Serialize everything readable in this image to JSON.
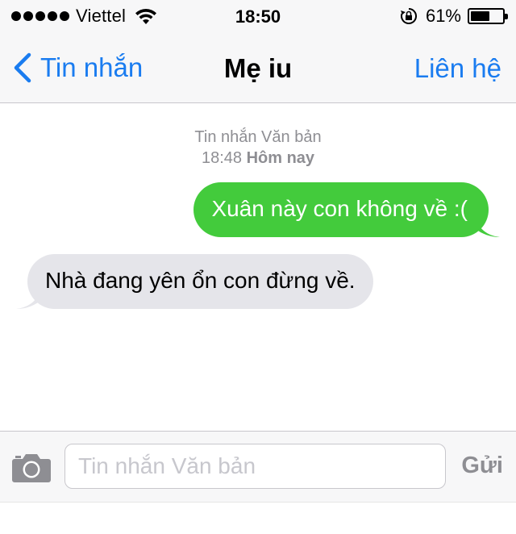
{
  "status_bar": {
    "carrier": "Viettel",
    "time": "18:50",
    "battery_percent": "61%",
    "battery_level": 0.61,
    "signal_bars": 5,
    "icons": [
      "signal-dots-icon",
      "wifi-icon",
      "rotation-lock-icon",
      "battery-icon"
    ]
  },
  "nav": {
    "back_label": "Tin nhắn",
    "title": "Mẹ iu",
    "contact_label": "Liên hệ",
    "accent_color": "#1a7cf0"
  },
  "conversation": {
    "timestamp_header": "Tin nhắn Văn bản",
    "timestamp_time": "18:48",
    "timestamp_day": "Hôm nay",
    "messages": [
      {
        "direction": "outgoing",
        "text": "Xuân này con không về :(",
        "color": "#43cb3c"
      },
      {
        "direction": "incoming",
        "text": "Nhà đang yên ổn con đừng về.",
        "color": "#e5e5ea"
      }
    ]
  },
  "composer": {
    "placeholder": "Tin nhắn Văn bản",
    "value": "",
    "send_label": "Gửi",
    "camera_icon": "camera-icon"
  }
}
